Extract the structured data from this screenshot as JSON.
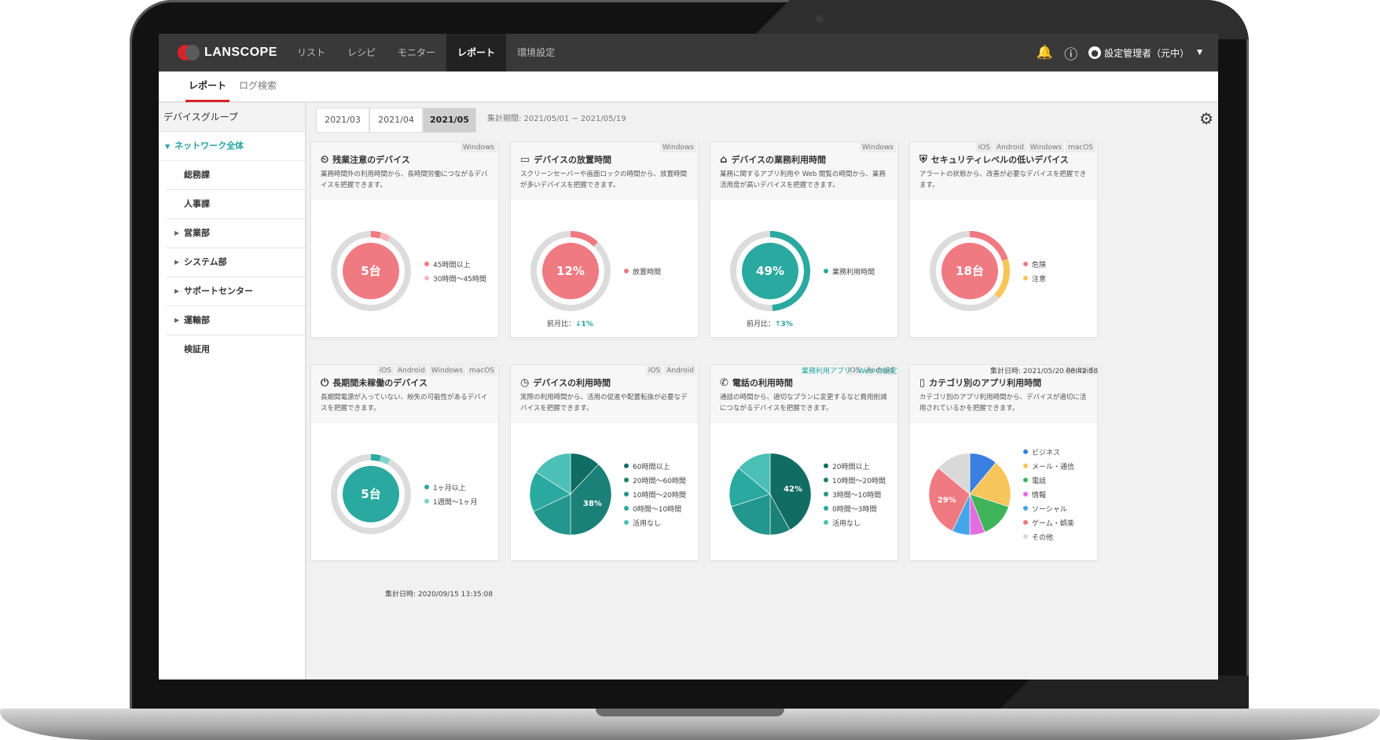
{
  "topbar": {
    "brand": "LANSCOPE",
    "nav": [
      "リスト",
      "レシピ",
      "モニター",
      "レポート",
      "環境設定"
    ],
    "active_nav": "レポート",
    "user_name": "設定管理者（元中）"
  },
  "tabs": [
    "レポート",
    "ログ検索"
  ],
  "sidebar": {
    "title": "デバイスグループ",
    "group": "ネットワーク全体",
    "items": [
      "総務課",
      "人事課",
      "営業部",
      "システム部",
      "サポートセンター",
      "運輸部",
      "検証用"
    ]
  },
  "dates": [
    "2021/03",
    "2021/04",
    "2021/05"
  ],
  "active_date": "2021/05",
  "period": "集計期間: 2021/05/01 ~ 2021/05/19",
  "footer_top": "集計日時: 2021/05/20 08:42:58",
  "footer_bottom": "集計日時: 2020/09/15 13:35:08",
  "settings_link": "業務利用アプリ・Web の設定",
  "cards": [
    {
      "title": "残業注意のデバイス",
      "icon": "user-clock-icon",
      "os": [
        "Windows"
      ],
      "desc": "業務時間外の利用時間から、長時間労働につながるデバイスを把握できます。",
      "center": "5台",
      "center_color": "#f07a82",
      "legend": [
        {
          "label": "45時間以上",
          "color": "#f07a82"
        },
        {
          "label": "30時間〜45時間",
          "color": "#f6b7bc"
        }
      ]
    },
    {
      "title": "デバイスの放置時間",
      "icon": "monitor-icon",
      "os": [
        "Windows"
      ],
      "desc": "スクリーンセーバーや画面ロックの時間から、放置時間が多いデバイスを把握できます。",
      "center": "12%",
      "center_color": "#f07a82",
      "legend": [
        {
          "label": "放置時間",
          "color": "#f07a82"
        }
      ],
      "compare_label": "前月比：",
      "compare_value": "↓1%"
    },
    {
      "title": "デバイスの業務利用時間",
      "icon": "user-desk-icon",
      "os": [
        "Windows"
      ],
      "desc": "業務に関するアプリ利用や Web 閲覧の時間から、業務活用度が高いデバイスを把握できます。",
      "center": "49%",
      "center_color": "#2aa9a0",
      "legend": [
        {
          "label": "業務利用時間",
          "color": "#2aa9a0"
        }
      ],
      "compare_label": "前月比：",
      "compare_value": "↑3%"
    },
    {
      "title": "セキュリティレベルの低いデバイス",
      "icon": "shield-check-icon",
      "os": [
        "iOS",
        "Android",
        "Windows",
        "macOS"
      ],
      "desc": "アラートの状態から、改善が必要なデバイスを把握できます。",
      "center": "18台",
      "center_color": "#f07a82",
      "legend": [
        {
          "label": "危険",
          "color": "#f07a82"
        },
        {
          "label": "注意",
          "color": "#f7c65a"
        }
      ]
    },
    {
      "title": "長期間未稼働のデバイス",
      "icon": "power-icon",
      "os": [
        "iOS",
        "Android",
        "Windows",
        "macOS"
      ],
      "desc": "長期間電源が入っていない、紛失の可能性があるデバイスを把握できます。",
      "center": "5台",
      "center_color": "#2aa9a0",
      "legend": [
        {
          "label": "1ヶ月以上",
          "color": "#2aa9a0"
        },
        {
          "label": "1週間〜1ヶ月",
          "color": "#7fd3cb"
        }
      ]
    },
    {
      "title": "デバイスの利用時間",
      "icon": "device-clock-icon",
      "os": [
        "iOS",
        "Android"
      ],
      "desc": "実際の利用時間から、活用の促進や配置転換が必要なデバイスを把握できます。",
      "center": "38%",
      "legend": [
        {
          "label": "60時間以上",
          "color": "#116c63"
        },
        {
          "label": "20時間〜60時間",
          "color": "#1b8078"
        },
        {
          "label": "10時間〜20時間",
          "color": "#23968d"
        },
        {
          "label": "0時間〜10時間",
          "color": "#2aa9a0"
        },
        {
          "label": "活用なし",
          "color": "#4cc0b6"
        }
      ]
    },
    {
      "title": "電話の利用時間",
      "icon": "phone-icon",
      "os": [
        "iOS",
        "Android"
      ],
      "desc": "通話の時間から、適切なプランに変更するなど費用削減につながるデバイスを把握できます。",
      "center": "42%",
      "legend": [
        {
          "label": "20時間以上",
          "color": "#116c63"
        },
        {
          "label": "10時間〜20時間",
          "color": "#1b8078"
        },
        {
          "label": "3時間〜10時間",
          "color": "#23968d"
        },
        {
          "label": "0時間〜3時間",
          "color": "#2aa9a0"
        },
        {
          "label": "活用なし",
          "color": "#4cc0b6"
        }
      ]
    },
    {
      "title": "カテゴリ別のアプリ利用時間",
      "icon": "smartphone-icon",
      "os": [
        "Android"
      ],
      "desc": "カテゴリ別のアプリ利用時間から、デバイスが適切に活用されているかを把握できます。",
      "center": "29%",
      "legend": [
        {
          "label": "ビジネス",
          "color": "#3b7fe0"
        },
        {
          "label": "メール・通信",
          "color": "#f7c65a"
        },
        {
          "label": "電話",
          "color": "#3fb45a"
        },
        {
          "label": "情報",
          "color": "#e46ee0"
        },
        {
          "label": "ソーシャル",
          "color": "#43a6e8"
        },
        {
          "label": "ゲーム・娯楽",
          "color": "#f07a82"
        },
        {
          "label": "その他",
          "color": "#d9d9d9"
        }
      ]
    }
  ],
  "chart_data": [
    {
      "type": "pie",
      "title": "残業注意のデバイス",
      "center_label": "5台",
      "categories": [
        "45時間以上",
        "30時間〜45時間"
      ],
      "values": [
        0.04,
        0.04
      ]
    },
    {
      "type": "pie",
      "title": "デバイスの放置時間",
      "center_label": "12%",
      "categories": [
        "放置時間"
      ],
      "values": [
        0.12
      ]
    },
    {
      "type": "pie",
      "title": "デバイスの業務利用時間",
      "center_label": "49%",
      "categories": [
        "業務利用時間"
      ],
      "values": [
        0.49
      ]
    },
    {
      "type": "pie",
      "title": "セキュリティレベルの低いデバイス",
      "center_label": "18台",
      "categories": [
        "危険",
        "注意"
      ],
      "values": [
        0.2,
        0.17
      ]
    },
    {
      "type": "pie",
      "title": "長期間未稼働のデバイス",
      "center_label": "5台",
      "categories": [
        "1ヶ月以上",
        "1週間〜1ヶ月"
      ],
      "values": [
        0.04,
        0.04
      ]
    },
    {
      "type": "pie",
      "title": "デバイスの利用時間",
      "categories": [
        "60時間以上",
        "20時間〜60時間",
        "10時間〜20時間",
        "0時間〜10時間",
        "活用なし"
      ],
      "values": [
        12,
        38,
        18,
        16,
        16
      ],
      "slice_labels": [
        "",
        "38%",
        "",
        "",
        ""
      ]
    },
    {
      "type": "pie",
      "title": "電話の利用時間",
      "categories": [
        "20時間以上",
        "10時間〜20時間",
        "3時間〜10時間",
        "0時間〜3時間",
        "活用なし"
      ],
      "values": [
        42,
        8,
        20,
        16,
        14
      ],
      "slice_labels": [
        "42%",
        "",
        "",
        "",
        ""
      ]
    },
    {
      "type": "pie",
      "title": "カテゴリ別のアプリ利用時間",
      "categories": [
        "ビジネス",
        "メール・通信",
        "電話",
        "情報",
        "ソーシャル",
        "ゲーム・娯楽",
        "その他"
      ],
      "values": [
        11,
        19,
        14,
        6,
        7,
        29,
        14
      ],
      "slice_labels": [
        "",
        "",
        "",
        "",
        "",
        "29%",
        ""
      ]
    }
  ]
}
